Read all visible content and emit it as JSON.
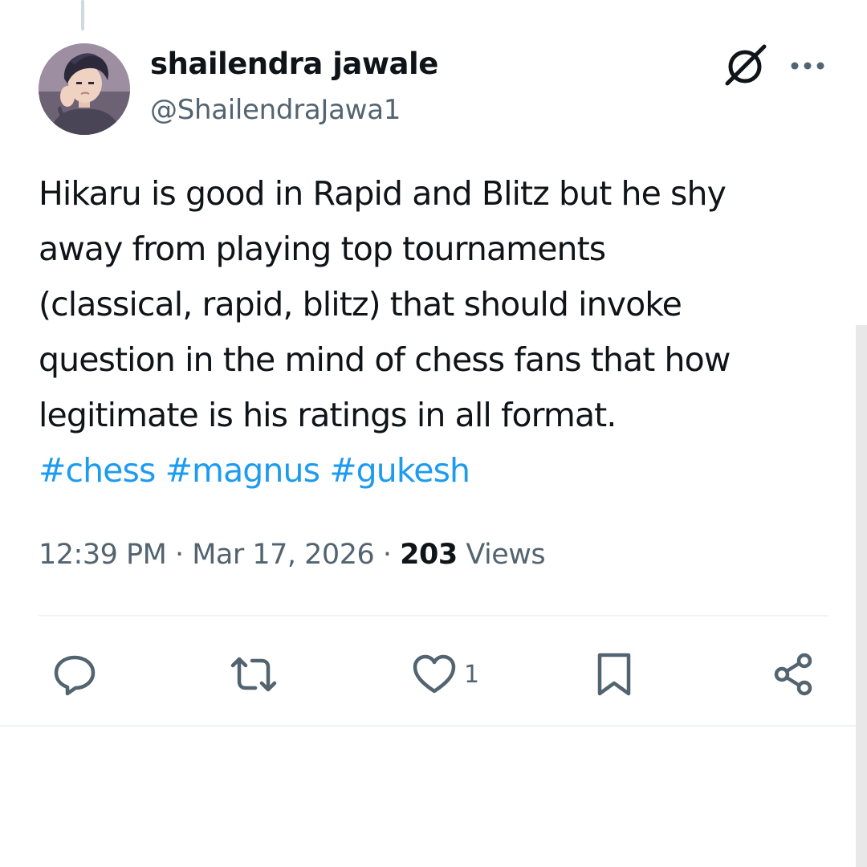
{
  "tweet": {
    "display_name": "shailendra jawale",
    "handle": "@ShailendraJawa1",
    "text_lines": [
      "Hikaru is good in Rapid and Blitz but he shy",
      "away from playing top tournaments",
      "(classical, rapid, blitz) that should invoke",
      "question in the mind of chess fans that how",
      "legitimate is his ratings in all format."
    ],
    "hashtags": [
      "#chess",
      "#magnus",
      "#gukesh"
    ],
    "time": "12:39 PM",
    "separator": "·",
    "date": "Mar 17, 2026",
    "views_count": "203",
    "views_label": "Views"
  },
  "actions": {
    "reply_icon": "reply-icon",
    "retweet_icon": "retweet-icon",
    "like_icon": "heart-icon",
    "like_count": "1",
    "bookmark_icon": "bookmark-icon",
    "share_icon": "share-icon"
  },
  "header_icons": {
    "grok": "grok-icon",
    "more": "more-icon"
  },
  "colors": {
    "text": "#0f1419",
    "secondary": "#536471",
    "hashtag": "#1d9bf0",
    "divider": "#eff3f4"
  }
}
